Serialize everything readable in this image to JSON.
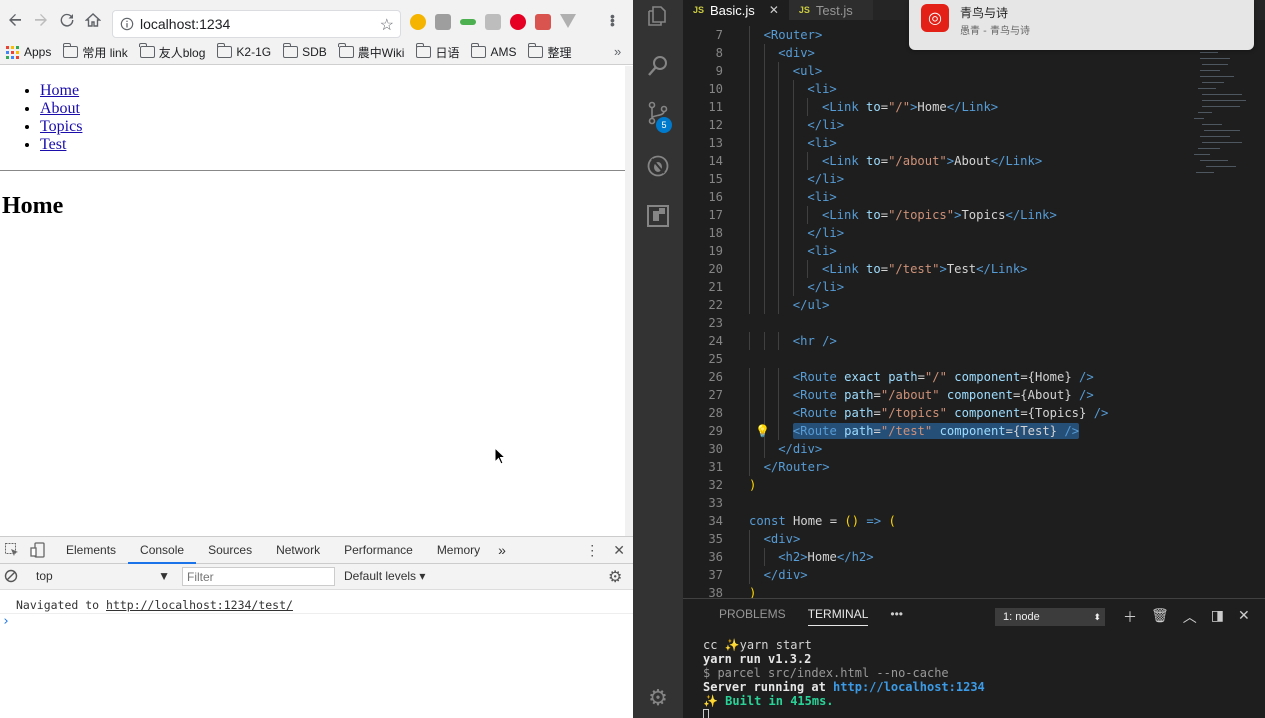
{
  "browser": {
    "url": "localhost:1234",
    "bookmarks": [
      {
        "label": "Apps",
        "type": "apps"
      },
      {
        "label": "常用 link",
        "type": "folder"
      },
      {
        "label": "友人blog",
        "type": "folder"
      },
      {
        "label": "K2-1G",
        "type": "folder"
      },
      {
        "label": "SDB",
        "type": "folder"
      },
      {
        "label": "農中Wiki",
        "type": "folder"
      },
      {
        "label": "日语",
        "type": "folder"
      },
      {
        "label": "AMS",
        "type": "folder"
      },
      {
        "label": "整理",
        "type": "folder"
      }
    ],
    "overflow": "»",
    "page": {
      "links": [
        "Home",
        "About",
        "Topics",
        "Test"
      ],
      "heading": "Home"
    }
  },
  "devtools": {
    "tabs": [
      "Elements",
      "Console",
      "Sources",
      "Network",
      "Performance",
      "Memory"
    ],
    "active_tab": "Console",
    "more": "»",
    "context": "top",
    "filter_placeholder": "Filter",
    "levels": "Default levels ▾",
    "message_prefix": "Navigated to ",
    "message_link": "http://localhost:1234/test/",
    "prompt": "›"
  },
  "editor": {
    "tabs": [
      {
        "label": "Basic.js",
        "active": true
      },
      {
        "label": "Test.js",
        "active": false
      }
    ],
    "scm_badge": "5",
    "code_lines": [
      {
        "n": "7",
        "indent": 1,
        "tokens": [
          [
            "tag",
            "<Router"
          ],
          [
            "tag",
            ">"
          ]
        ]
      },
      {
        "n": "8",
        "indent": 2,
        "tokens": [
          [
            "tag",
            "<div"
          ],
          [
            "tag",
            ">"
          ]
        ]
      },
      {
        "n": "9",
        "indent": 3,
        "tokens": [
          [
            "tag",
            "<ul"
          ],
          [
            "tag",
            ">"
          ]
        ]
      },
      {
        "n": "10",
        "indent": 4,
        "tokens": [
          [
            "tag",
            "<li"
          ],
          [
            "tag",
            ">"
          ]
        ]
      },
      {
        "n": "11",
        "indent": 5,
        "tokens": [
          [
            "tag",
            "<Link"
          ],
          [
            "pl",
            " "
          ],
          [
            "attr",
            "to"
          ],
          [
            "pl",
            "="
          ],
          [
            "str",
            "\"/\""
          ],
          [
            "tag",
            ">"
          ],
          [
            "pl",
            "Home"
          ],
          [
            "tag",
            "</Link>"
          ]
        ]
      },
      {
        "n": "12",
        "indent": 4,
        "tokens": [
          [
            "tag",
            "</li>"
          ]
        ]
      },
      {
        "n": "13",
        "indent": 4,
        "tokens": [
          [
            "tag",
            "<li"
          ],
          [
            "tag",
            ">"
          ]
        ]
      },
      {
        "n": "14",
        "indent": 5,
        "tokens": [
          [
            "tag",
            "<Link"
          ],
          [
            "pl",
            " "
          ],
          [
            "attr",
            "to"
          ],
          [
            "pl",
            "="
          ],
          [
            "str",
            "\"/about\""
          ],
          [
            "tag",
            ">"
          ],
          [
            "pl",
            "About"
          ],
          [
            "tag",
            "</Link>"
          ]
        ]
      },
      {
        "n": "15",
        "indent": 4,
        "tokens": [
          [
            "tag",
            "</li>"
          ]
        ]
      },
      {
        "n": "16",
        "indent": 4,
        "tokens": [
          [
            "tag",
            "<li"
          ],
          [
            "tag",
            ">"
          ]
        ]
      },
      {
        "n": "17",
        "indent": 5,
        "tokens": [
          [
            "tag",
            "<Link"
          ],
          [
            "pl",
            " "
          ],
          [
            "attr",
            "to"
          ],
          [
            "pl",
            "="
          ],
          [
            "str",
            "\"/topics\""
          ],
          [
            "tag",
            ">"
          ],
          [
            "pl",
            "Topics"
          ],
          [
            "tag",
            "</Link>"
          ]
        ]
      },
      {
        "n": "18",
        "indent": 4,
        "tokens": [
          [
            "tag",
            "</li>"
          ]
        ]
      },
      {
        "n": "19",
        "indent": 4,
        "tokens": [
          [
            "tag",
            "<li"
          ],
          [
            "tag",
            ">"
          ]
        ]
      },
      {
        "n": "20",
        "indent": 5,
        "tokens": [
          [
            "tag",
            "<Link"
          ],
          [
            "pl",
            " "
          ],
          [
            "attr",
            "to"
          ],
          [
            "pl",
            "="
          ],
          [
            "str",
            "\"/test\""
          ],
          [
            "tag",
            ">"
          ],
          [
            "pl",
            "Test"
          ],
          [
            "tag",
            "</Link>"
          ]
        ]
      },
      {
        "n": "21",
        "indent": 4,
        "tokens": [
          [
            "tag",
            "</li>"
          ]
        ]
      },
      {
        "n": "22",
        "indent": 3,
        "tokens": [
          [
            "tag",
            "</ul>"
          ]
        ]
      },
      {
        "n": "23",
        "indent": 0,
        "tokens": []
      },
      {
        "n": "24",
        "indent": 3,
        "tokens": [
          [
            "tag",
            "<hr"
          ],
          [
            "pl",
            " "
          ],
          [
            "tag",
            "/>"
          ]
        ]
      },
      {
        "n": "25",
        "indent": 0,
        "tokens": []
      },
      {
        "n": "26",
        "indent": 3,
        "tokens": [
          [
            "tag",
            "<Route"
          ],
          [
            "pl",
            " "
          ],
          [
            "attr",
            "exact"
          ],
          [
            "pl",
            " "
          ],
          [
            "attr",
            "path"
          ],
          [
            "pl",
            "="
          ],
          [
            "str",
            "\"/\""
          ],
          [
            "pl",
            " "
          ],
          [
            "attr",
            "component"
          ],
          [
            "pl",
            "={Home}"
          ],
          [
            "pl",
            " "
          ],
          [
            "tag",
            "/>"
          ]
        ]
      },
      {
        "n": "27",
        "indent": 3,
        "tokens": [
          [
            "tag",
            "<Route"
          ],
          [
            "pl",
            " "
          ],
          [
            "attr",
            "path"
          ],
          [
            "pl",
            "="
          ],
          [
            "str",
            "\"/about\""
          ],
          [
            "pl",
            " "
          ],
          [
            "attr",
            "component"
          ],
          [
            "pl",
            "={About}"
          ],
          [
            "pl",
            " "
          ],
          [
            "tag",
            "/>"
          ]
        ]
      },
      {
        "n": "28",
        "indent": 3,
        "tokens": [
          [
            "tag",
            "<Route"
          ],
          [
            "pl",
            " "
          ],
          [
            "attr",
            "path"
          ],
          [
            "pl",
            "="
          ],
          [
            "str",
            "\"/topics\""
          ],
          [
            "pl",
            " "
          ],
          [
            "attr",
            "component"
          ],
          [
            "pl",
            "={Topics}"
          ],
          [
            "pl",
            " "
          ],
          [
            "tag",
            "/>"
          ]
        ]
      },
      {
        "n": "29",
        "indent": 3,
        "highlight": true,
        "tokens": [
          [
            "tag",
            "<Route"
          ],
          [
            "pl",
            " "
          ],
          [
            "attr",
            "path"
          ],
          [
            "pl",
            "="
          ],
          [
            "str",
            "\"/test\""
          ],
          [
            "pl",
            " "
          ],
          [
            "attr",
            "component"
          ],
          [
            "pl",
            "={Test}"
          ],
          [
            "pl",
            " "
          ],
          [
            "tag",
            "/>"
          ]
        ]
      },
      {
        "n": "30",
        "indent": 2,
        "tokens": [
          [
            "tag",
            "</div>"
          ]
        ]
      },
      {
        "n": "31",
        "indent": 1,
        "tokens": [
          [
            "tag",
            "</Router>"
          ]
        ]
      },
      {
        "n": "32",
        "indent": 0,
        "tokens": [
          [
            "brace",
            ")"
          ]
        ]
      },
      {
        "n": "33",
        "indent": 0,
        "tokens": []
      },
      {
        "n": "34",
        "indent": 0,
        "tokens": [
          [
            "kw",
            "const"
          ],
          [
            "pl",
            " Home = "
          ],
          [
            "brace",
            "()"
          ],
          [
            "pl",
            " "
          ],
          [
            "kw",
            "=>"
          ],
          [
            "pl",
            " "
          ],
          [
            "brace",
            "("
          ]
        ]
      },
      {
        "n": "35",
        "indent": 1,
        "tokens": [
          [
            "tag",
            "<div"
          ],
          [
            "tag",
            ">"
          ]
        ]
      },
      {
        "n": "36",
        "indent": 2,
        "tokens": [
          [
            "tag",
            "<h2"
          ],
          [
            "tag",
            ">"
          ],
          [
            "pl",
            "Home"
          ],
          [
            "tag",
            "</h2>"
          ]
        ]
      },
      {
        "n": "37",
        "indent": 1,
        "tokens": [
          [
            "tag",
            "</div>"
          ]
        ]
      },
      {
        "n": "38",
        "indent": 0,
        "tokens": [
          [
            "brace",
            ")"
          ]
        ]
      }
    ]
  },
  "panel": {
    "tabs": [
      "PROBLEMS",
      "TERMINAL"
    ],
    "active_tab": "TERMINAL",
    "more": "•••",
    "terminal_select": "1: node",
    "lines": [
      {
        "parts": [
          [
            "pl",
            "cc ✨"
          ],
          [
            "pl",
            "yarn start"
          ]
        ]
      },
      {
        "parts": [
          [
            "t-bold",
            "yarn run v1.3.2"
          ]
        ]
      },
      {
        "parts": [
          [
            "t-dim",
            "$ parcel src/index.html --no-cache"
          ]
        ]
      },
      {
        "parts": [
          [
            "t-bold",
            "Server running at "
          ],
          [
            "t-link",
            "http://localhost:1234"
          ]
        ]
      },
      {
        "parts": [
          [
            "t-green",
            "✨  Built in 415ms."
          ]
        ]
      }
    ]
  },
  "notification": {
    "title": "青鸟与诗",
    "subtitle": "愚青 - 青鸟与诗",
    "app_color": "#e32117"
  },
  "colors": {
    "vscode_bg": "#1e1e1e",
    "activity_bar": "#333333",
    "accent": "#007acc",
    "link": "#1a0dab"
  }
}
